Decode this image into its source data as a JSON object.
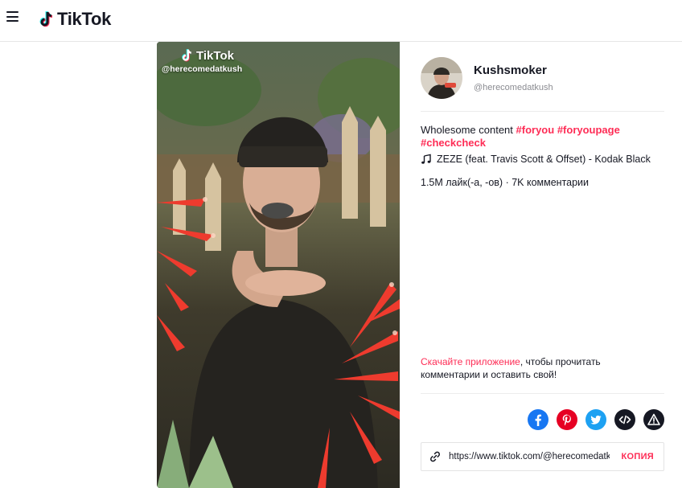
{
  "header": {
    "logo_text": "TikTok"
  },
  "video": {
    "watermark_brand": "TikTok",
    "watermark_user": "@herecomedatkush"
  },
  "author": {
    "name": "Kushsmoker",
    "handle": "@herecomedatkush"
  },
  "description": {
    "text": "Wholesome content ",
    "hashtags": [
      "#foryou",
      "#foryoupage",
      "#checkcheck"
    ]
  },
  "music": {
    "title": "ZEZE (feat. Travis Scott & Offset) - Kodak Black"
  },
  "stats": {
    "text": "1.5M лайк(-а, -ов) · 7K комментарии"
  },
  "cta": {
    "link_text": "Скачайте приложение",
    "rest_text": ", чтобы прочитать комментарии и оставить свой!"
  },
  "share": {
    "items": [
      "facebook-icon",
      "pinterest-icon",
      "twitter-icon",
      "embed-icon",
      "report-icon"
    ],
    "colors": {
      "facebook": "#1877f2",
      "pinterest": "#e60023",
      "twitter": "#1da1f2",
      "embed": "#161823",
      "report": "#161823"
    }
  },
  "copy_link": {
    "url": "https://www.tiktok.com/@herecomedatkush",
    "button_label": "КОПИЯ"
  },
  "colors": {
    "accent": "#fe2c55",
    "text": "#161823",
    "muted": "#8a8b91"
  }
}
